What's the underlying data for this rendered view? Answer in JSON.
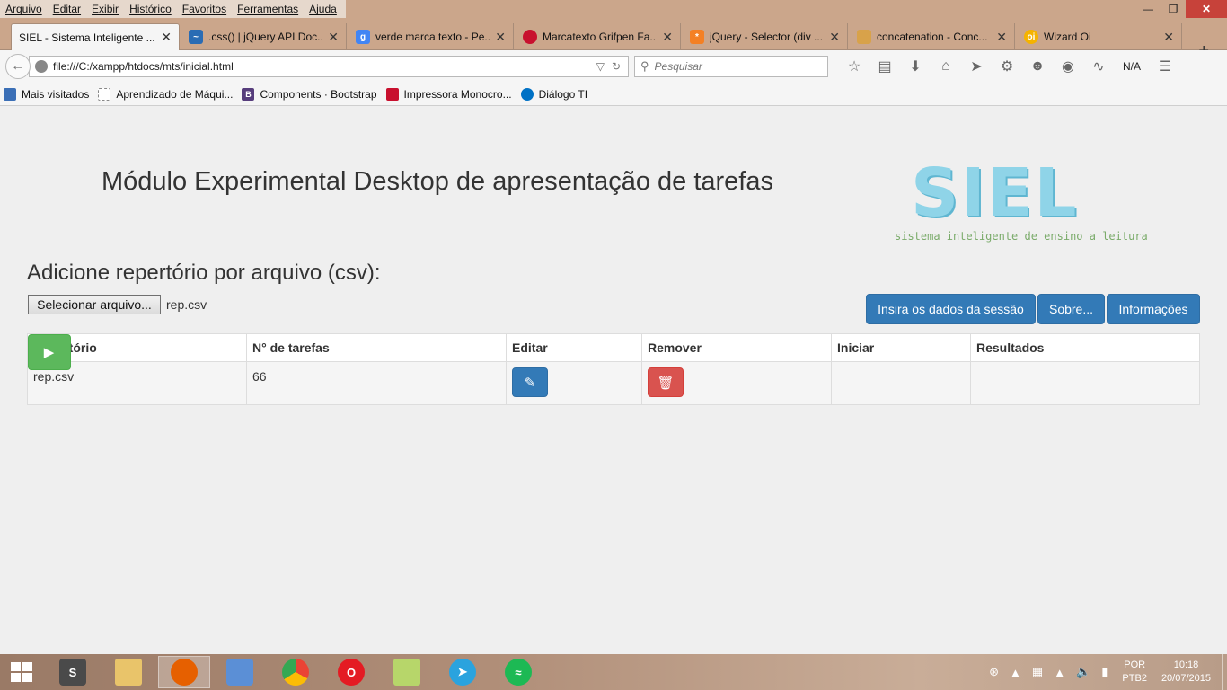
{
  "browser": {
    "menu": [
      "Arquivo",
      "Editar",
      "Exibir",
      "Histórico",
      "Favoritos",
      "Ferramentas",
      "Ajuda"
    ],
    "tabs": [
      {
        "title": "SIEL - Sistema Inteligente ...",
        "favicon_color": "#f5f5f5",
        "active": true
      },
      {
        "title": ".css() | jQuery API Doc...",
        "favicon_color": "#2a6cb4"
      },
      {
        "title": "verde marca texto - Pe...",
        "favicon_color": "#4285f4"
      },
      {
        "title": "Marcatexto Grifpen Fa...",
        "favicon_color": "#c8102e"
      },
      {
        "title": "jQuery - Selector (div ...",
        "favicon_color": "#f48024"
      },
      {
        "title": "concatenation - Conc...",
        "favicon_color": "#d8a24a"
      },
      {
        "title": "Wizard Oi",
        "favicon_color": "#f5b300"
      }
    ],
    "url": "file:///C:/xampp/htdocs/mts/inicial.html",
    "search_placeholder": "Pesquisar",
    "toolbar_status": "N/A",
    "bookmarks": [
      {
        "label": "Mais visitados",
        "icon_color": "#3b6fb6"
      },
      {
        "label": "Aprendizado de Máqui...",
        "icon_color": "#ffffff"
      },
      {
        "label": "Components · Bootstrap",
        "icon_color": "#563d7c",
        "icon_text": "B"
      },
      {
        "label": "Impressora Monocro...",
        "icon_color": "#c8102e"
      },
      {
        "label": "Diálogo TI",
        "icon_color": "#0071c5"
      }
    ]
  },
  "page": {
    "title": "Módulo Experimental Desktop de apresentação de tarefas",
    "logo": {
      "word": "SIEL",
      "tagline": "sistema inteligente de ensino a leitura"
    },
    "upload": {
      "heading": "Adicione repertório por arquivo (csv):",
      "button_label": "Selecionar arquivo...",
      "file_name": "rep.csv"
    },
    "actions": {
      "session": "Insira os dados da sessão",
      "about": "Sobre...",
      "info": "Informações"
    },
    "table": {
      "headers": [
        "Repertório",
        "N° de tarefas",
        "Editar",
        "Remover",
        "Iniciar",
        "Resultados"
      ],
      "rows": [
        {
          "repertorio": "rep.csv",
          "tarefas": "66",
          "resultados": ""
        }
      ]
    },
    "colors": {
      "primary": "#337ab7",
      "danger": "#d9534f",
      "success": "#5cb85c"
    }
  },
  "taskbar": {
    "apps": [
      {
        "name": "sublime-text",
        "color": "#4a4a4a",
        "label": "S"
      },
      {
        "name": "file-explorer",
        "color": "#e9c46a",
        "label": ""
      },
      {
        "name": "firefox",
        "color": "#e66000",
        "label": "",
        "active": true
      },
      {
        "name": "virtualbox",
        "color": "#5b8fd6",
        "label": ""
      },
      {
        "name": "chrome",
        "color": "#34a853",
        "label": ""
      },
      {
        "name": "opera",
        "color": "#e41b23",
        "label": "O"
      },
      {
        "name": "sticky-notes",
        "color": "#b7d66a",
        "label": ""
      },
      {
        "name": "telegram",
        "color": "#2aa3de",
        "label": ""
      },
      {
        "name": "spotify",
        "color": "#1db954",
        "label": ""
      }
    ],
    "language": {
      "line1": "POR",
      "line2": "PTB2"
    },
    "clock": {
      "time": "10:18",
      "date": "20/07/2015"
    }
  }
}
